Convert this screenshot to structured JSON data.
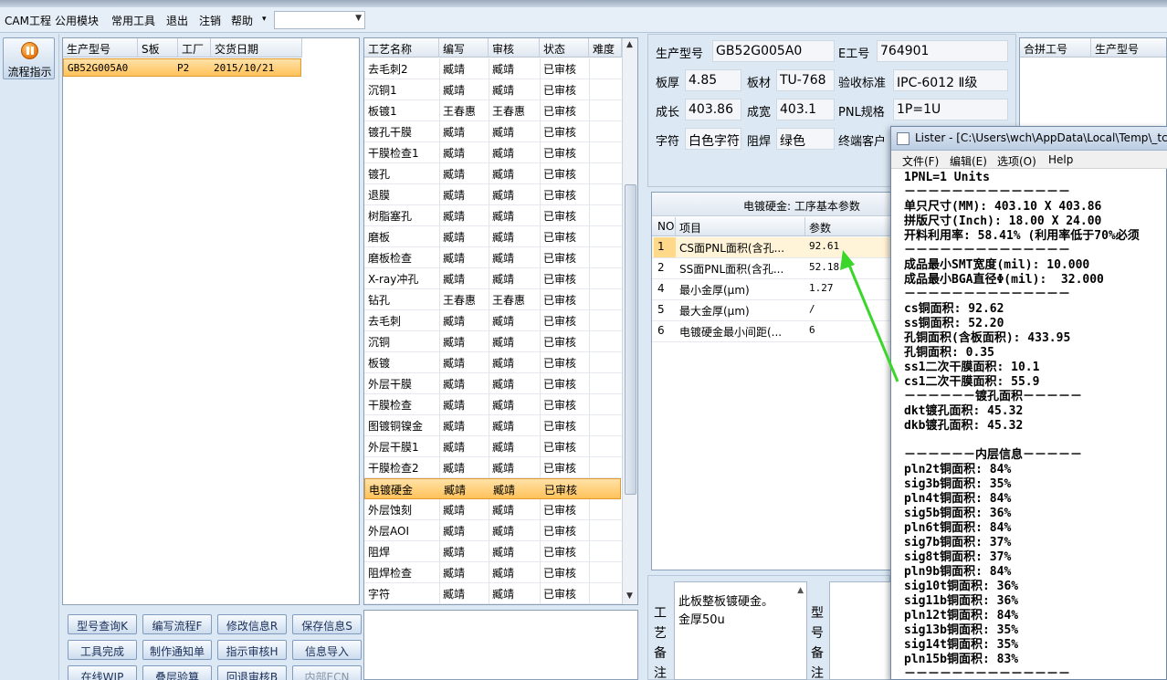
{
  "menu": [
    "CAM工程",
    "公用模块",
    "常用工具",
    "退出",
    "注销",
    "帮助"
  ],
  "flow_button": "流程指示",
  "order_grid": {
    "headers": [
      "生产型号",
      "S板",
      "工厂",
      "交货日期"
    ],
    "rows": [
      [
        "GB52G005A0",
        "",
        "P2",
        "2015/10/21"
      ]
    ]
  },
  "process_grid": {
    "headers": [
      "工艺名称",
      "编写",
      "审核",
      "状态",
      "难度"
    ],
    "rows": [
      [
        "去毛刺2",
        "臧靖",
        "臧靖",
        "已审核"
      ],
      [
        "沉铜1",
        "臧靖",
        "臧靖",
        "已审核"
      ],
      [
        "板镀1",
        "王春惠",
        "王春惠",
        "已审核"
      ],
      [
        "镀孔干膜",
        "臧靖",
        "臧靖",
        "已审核"
      ],
      [
        "干膜检查1",
        "臧靖",
        "臧靖",
        "已审核"
      ],
      [
        "镀孔",
        "臧靖",
        "臧靖",
        "已审核"
      ],
      [
        "退膜",
        "臧靖",
        "臧靖",
        "已审核"
      ],
      [
        "树脂塞孔",
        "臧靖",
        "臧靖",
        "已审核"
      ],
      [
        "磨板",
        "臧靖",
        "臧靖",
        "已审核"
      ],
      [
        "磨板检查",
        "臧靖",
        "臧靖",
        "已审核"
      ],
      [
        "X-ray冲孔",
        "臧靖",
        "臧靖",
        "已审核"
      ],
      [
        "钻孔",
        "王春惠",
        "王春惠",
        "已审核"
      ],
      [
        "去毛刺",
        "臧靖",
        "臧靖",
        "已审核"
      ],
      [
        "沉铜",
        "臧靖",
        "臧靖",
        "已审核"
      ],
      [
        "板镀",
        "臧靖",
        "臧靖",
        "已审核"
      ],
      [
        "外层干膜",
        "臧靖",
        "臧靖",
        "已审核"
      ],
      [
        "干膜检查",
        "臧靖",
        "臧靖",
        "已审核"
      ],
      [
        "图镀铜镍金",
        "臧靖",
        "臧靖",
        "已审核"
      ],
      [
        "外层干膜1",
        "臧靖",
        "臧靖",
        "已审核"
      ],
      [
        "干膜检查2",
        "臧靖",
        "臧靖",
        "已审核"
      ],
      [
        "电镀硬金",
        "臧靖",
        "臧靖",
        "已审核"
      ],
      [
        "外层蚀刻",
        "臧靖",
        "臧靖",
        "已审核"
      ],
      [
        "外层AOI",
        "臧靖",
        "臧靖",
        "已审核"
      ],
      [
        "阻焊",
        "臧靖",
        "臧靖",
        "已审核"
      ],
      [
        "阻焊检查",
        "臧靖",
        "臧靖",
        "已审核"
      ],
      [
        "字符",
        "臧靖",
        "臧靖",
        "已审核"
      ]
    ]
  },
  "buttons": [
    [
      "型号查询K",
      "编写流程F",
      "修改信息R",
      "保存信息S"
    ],
    [
      "工具完成",
      "制作通知单",
      "指示审核H",
      "信息导入"
    ],
    [
      "在线WIP",
      "叠层验算",
      "回退审核B",
      "内部ECN"
    ]
  ],
  "info": {
    "labels": [
      "生产型号",
      "E工号",
      "板厚",
      "板材",
      "验收标准",
      "成长",
      "成宽",
      "PNL规格",
      "字符",
      "阻焊",
      "终端客户"
    ],
    "values": [
      "GB52G005A0",
      "764901",
      "4.85",
      "TU-768",
      "IPC-6012 Ⅱ级",
      "403.86",
      "403.1",
      "1P=1U",
      "白色字符",
      "绿色"
    ]
  },
  "merge_grid": {
    "headers": [
      "合拼工号",
      "生产型号"
    ]
  },
  "param_panel": {
    "title": "电镀硬金: 工序基本参数",
    "headers": [
      "NO",
      "项目",
      "参数"
    ],
    "rows": [
      [
        "1",
        "CS面PNL面积(含孔...",
        "92.61"
      ],
      [
        "2",
        "SS面PNL面积(含孔...",
        "52.18"
      ],
      [
        "4",
        "最小金厚(μm)",
        "1.27"
      ],
      [
        "5",
        "最大金厚(μm)",
        "/"
      ],
      [
        "6",
        "电镀硬金最小间距(...",
        "6"
      ]
    ]
  },
  "remark": {
    "label": [
      "工",
      "艺",
      "备",
      "注"
    ],
    "text": [
      "此板整板镀硬金。",
      "金厚50u"
    ],
    "label2": [
      "型",
      "号",
      "备",
      "注"
    ]
  },
  "lister": {
    "title": "Lister - [C:\\Users\\wch\\AppData\\Local\\Temp\\_tc\\",
    "menu": [
      "文件(F)",
      "编辑(E)",
      "选项(O)",
      "Help"
    ],
    "lines": [
      "1PNL=1 Units",
      "－－－－－－－－－－－－－－",
      "单只尺寸(MM): 403.10 X 403.86",
      "拼版尺寸(Inch): 18.00 X 24.00",
      "开料利用率: 58.41% (利用率低于70%必须",
      "－－－－－－－－－－－－－－",
      "成品最小SMT宽度(mil): 10.000",
      "成品最小BGA直径Φ(mil):  32.000",
      "－－－－－－－－－－－－－－",
      "cs铜面积: 92.62",
      "ss铜面积: 52.20",
      "孔铜面积(含板面积): 433.95",
      "孔铜面积: 0.35",
      "ss1二次干膜面积: 10.1",
      "cs1二次干膜面积: 55.9",
      "－－－－－－镀孔面积－－－－－",
      "dkt镀孔面积: 45.32",
      "dkb镀孔面积: 45.32",
      "",
      "－－－－－－内层信息－－－－－",
      "pln2t铜面积: 84%",
      "sig3b铜面积: 35%",
      "pln4t铜面积: 84%",
      "sig5b铜面积: 36%",
      "pln6t铜面积: 84%",
      "sig7b铜面积: 37%",
      "sig8t铜面积: 37%",
      "pln9b铜面积: 84%",
      "sig10t铜面积: 36%",
      "sig11b铜面积: 36%",
      "pln12t铜面积: 84%",
      "sig13b铜面积: 35%",
      "sig14t铜面积: 35%",
      "pln15b铜面积: 83%",
      "－－－－－－－－－－－－－－"
    ]
  }
}
